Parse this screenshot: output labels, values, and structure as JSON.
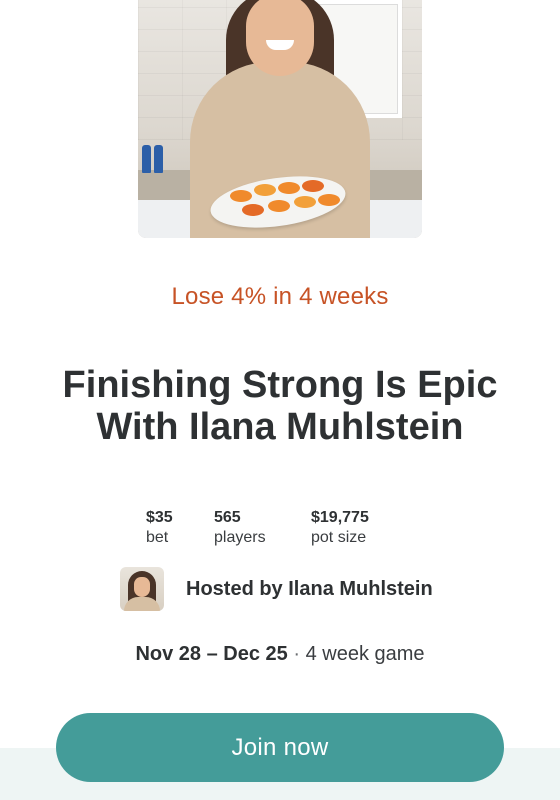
{
  "hero": {
    "image": "woman-holding-plate-of-stuffed-peppers"
  },
  "game": {
    "goal": "Lose 4% in 4 weeks",
    "title": "Finishing Strong Is Epic With Ilana Muhlstein",
    "stats": {
      "bet_value": "$35",
      "bet_label": "bet",
      "players_value": "565",
      "players_label": "players",
      "pot_value": "$19,775",
      "pot_label": "pot size"
    },
    "host": {
      "label": "Hosted by Ilana Muhlstein",
      "avatar": "host-avatar"
    },
    "dates": {
      "range": "Nov 28 – Dec 25",
      "separator": "·",
      "length": "4 week game"
    }
  },
  "cta": {
    "join_label": "Join now"
  },
  "colors": {
    "accent": "#449c99",
    "goal": "#c75326",
    "text": "#2e3133"
  }
}
